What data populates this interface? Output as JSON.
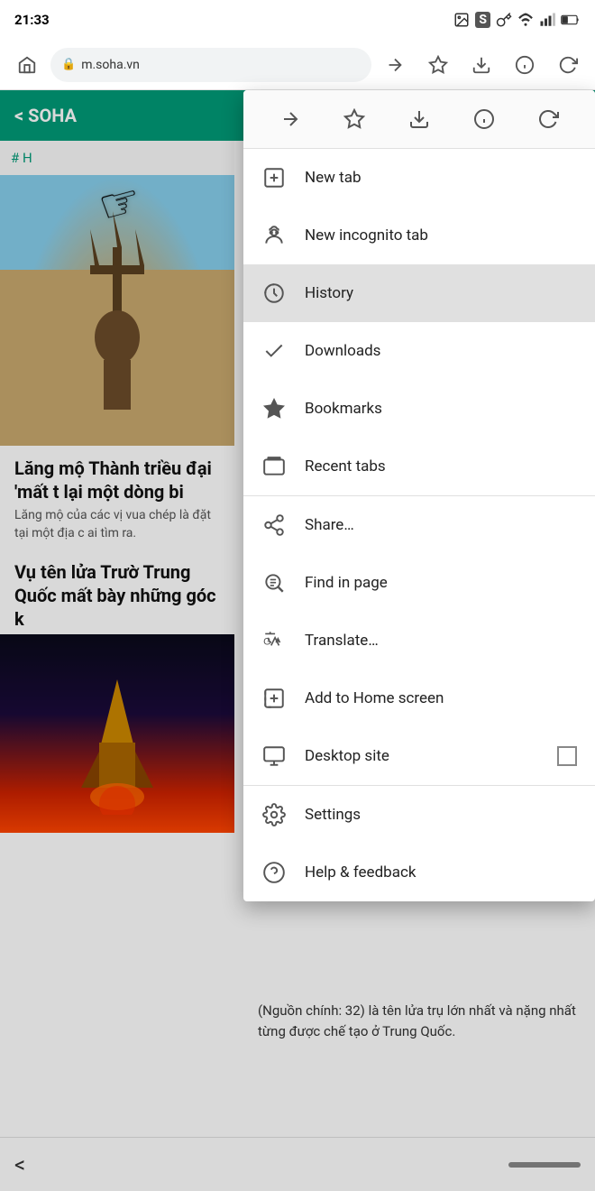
{
  "statusBar": {
    "time": "21:33",
    "icons": [
      "image",
      "S",
      "key",
      "wifi",
      "signal",
      "battery"
    ]
  },
  "browserToolbar": {
    "backLabel": "→",
    "bookmarkLabel": "☆",
    "downloadLabel": "⬇",
    "infoLabel": "ⓘ",
    "reloadLabel": "↻",
    "addressText": "m.soha.vn",
    "lockIcon": "🔒"
  },
  "sohaHeader": {
    "back": "< SOHA"
  },
  "hashtagBar": {
    "text": "# H"
  },
  "menuIconRow": {
    "icons": [
      "forward",
      "bookmark-star",
      "download",
      "info",
      "reload"
    ]
  },
  "menuItems": [
    {
      "id": "new-tab",
      "label": "New tab",
      "icon": "new-tab",
      "highlighted": false,
      "divider": false
    },
    {
      "id": "new-incognito-tab",
      "label": "New incognito tab",
      "icon": "incognito",
      "highlighted": false,
      "divider": false
    },
    {
      "id": "history",
      "label": "History",
      "icon": "history",
      "highlighted": true,
      "divider": false
    },
    {
      "id": "downloads",
      "label": "Downloads",
      "icon": "check",
      "highlighted": false,
      "divider": false
    },
    {
      "id": "bookmarks",
      "label": "Bookmarks",
      "icon": "star",
      "highlighted": false,
      "divider": false
    },
    {
      "id": "recent-tabs",
      "label": "Recent tabs",
      "icon": "recent-tabs",
      "highlighted": false,
      "divider": false
    },
    {
      "id": "share",
      "label": "Share…",
      "icon": "share",
      "highlighted": false,
      "divider": true
    },
    {
      "id": "find-in-page",
      "label": "Find in page",
      "icon": "find",
      "highlighted": false,
      "divider": false
    },
    {
      "id": "translate",
      "label": "Translate…",
      "icon": "translate",
      "highlighted": false,
      "divider": false
    },
    {
      "id": "add-to-home",
      "label": "Add to Home screen",
      "icon": "add-home",
      "highlighted": false,
      "divider": false
    },
    {
      "id": "desktop-site",
      "label": "Desktop site",
      "icon": "desktop",
      "highlighted": false,
      "divider": false,
      "checkbox": true
    },
    {
      "id": "settings",
      "label": "Settings",
      "icon": "settings",
      "highlighted": false,
      "divider": true
    },
    {
      "id": "help-feedback",
      "label": "Help & feedback",
      "icon": "help",
      "highlighted": false,
      "divider": false
    }
  ],
  "pageContent": {
    "articleTitle": "Lăng mộ Thành triều đại 'mất t lại một dòng bi",
    "articleSubtitle": "Lăng mộ của các vị vua chép là đặt tại một địa c ai tìm ra.",
    "articleTitle2": "Vụ tên lửa Trườ Trung Quốc mất bày những góc k",
    "bottomText": "(Nguồn chính: 32) là tên lửa trụ lớn nhất và nặng nhất từng được chế tạo ở Trung Quốc."
  },
  "navBar": {
    "backLabel": "<"
  }
}
